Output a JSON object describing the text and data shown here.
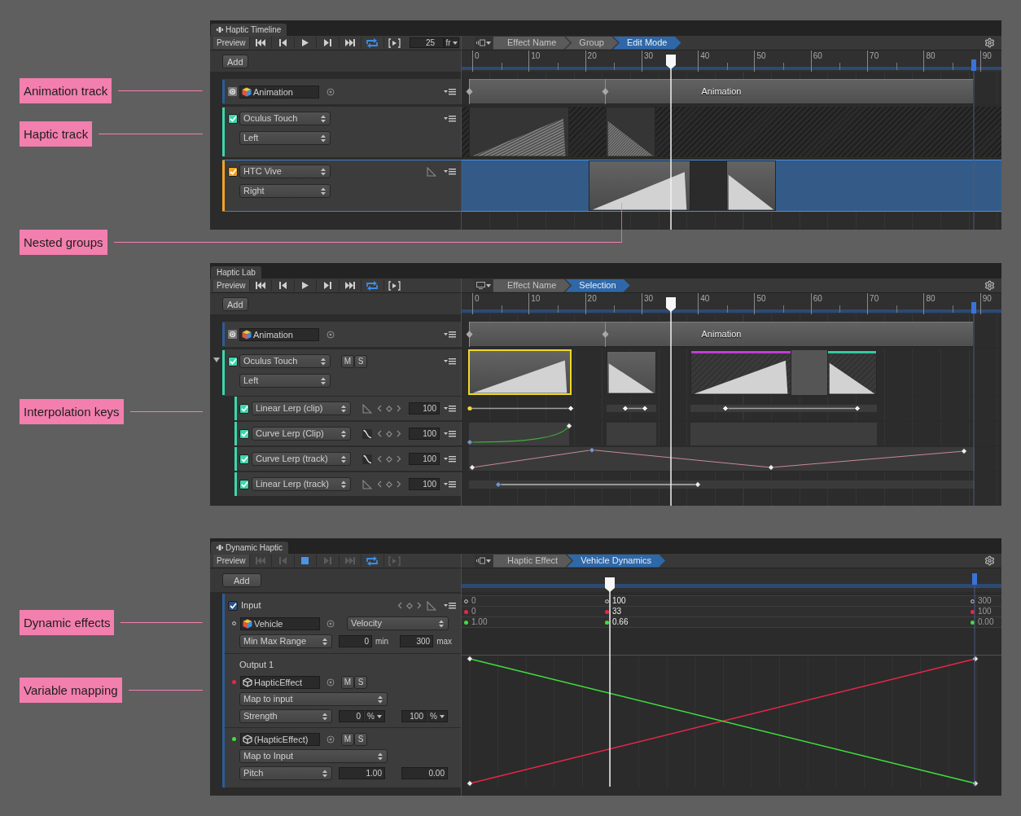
{
  "annotations": [
    {
      "text": "Animation track"
    },
    {
      "text": "Haptic track"
    },
    {
      "text": "Nested groups"
    },
    {
      "text": "Interpolation keys"
    },
    {
      "text": "Dynamic effects"
    },
    {
      "text": "Variable mapping"
    }
  ],
  "panels": [
    {
      "kind": "timeline",
      "tab": {
        "title": "Haptic Timeline",
        "icon": true
      },
      "toolbar": {
        "preview": "Preview",
        "playing": false,
        "loop": true,
        "frame": "25",
        "unit": "fr"
      },
      "breadcrumb": [
        {
          "label": "Effect Name",
          "selected": false
        },
        {
          "label": "Group",
          "selected": false
        },
        {
          "label": "Edit Mode",
          "selected": true
        }
      ],
      "add": "Add",
      "ruler": [
        "0",
        "10",
        "20",
        "30",
        "40",
        "50",
        "60",
        "70",
        "80",
        "90"
      ],
      "tracks": [
        {
          "kind": "animation",
          "color": "#2d5c96",
          "selected": false,
          "object": "Animation",
          "clip": "Animation"
        },
        {
          "kind": "haptic",
          "color": "#3dd6ac",
          "checked": true,
          "selected": false,
          "device": "Oculus Touch",
          "hand": "Left",
          "clips": [
            {
              "selected": false
            },
            {
              "selected": false
            }
          ]
        },
        {
          "kind": "haptic",
          "color": "#f3a423",
          "checked": true,
          "selected": true,
          "device": "HTC Vive",
          "hand": "Right",
          "curve_icon": true,
          "clips": [
            {
              "selected": false
            },
            {
              "selected": false
            }
          ]
        }
      ]
    },
    {
      "kind": "timeline",
      "tab": {
        "title": "Haptic Lab"
      },
      "toolbar": {
        "preview": "Preview",
        "playing": false,
        "loop": true
      },
      "breadcrumb": [
        {
          "label": "Effect Name",
          "selected": false
        },
        {
          "label": "Selection",
          "selected": true
        }
      ],
      "add": "Add",
      "ruler": [
        "0",
        "10",
        "20",
        "30",
        "40",
        "50",
        "60",
        "70",
        "80",
        "90"
      ],
      "tracks": [
        {
          "kind": "animation",
          "color": "#2d5c96",
          "selected": false,
          "object": "Animation",
          "clip": "Animation"
        },
        {
          "kind": "haptic",
          "color": "#3dd6ac",
          "checked": true,
          "selected": false,
          "expanded": true,
          "device": "Oculus Touch",
          "hand": "Left",
          "buttons": [
            "M",
            "S"
          ],
          "clips": [
            {
              "selected": true
            },
            {
              "selected": false
            },
            {
              "selected": false,
              "color": "#c43bd9"
            },
            {
              "selected": false,
              "color": "#33c9a2"
            }
          ],
          "children": [
            {
              "kind": "linear",
              "checked": true,
              "mode": "Linear Lerp (clip)",
              "value": "100"
            },
            {
              "kind": "ease",
              "checked": true,
              "mode": "Curve Lerp (Clip)",
              "value": "100"
            },
            {
              "kind": "ease",
              "checked": true,
              "mode": "Curve Lerp (track)",
              "value": "100"
            },
            {
              "kind": "linear",
              "checked": true,
              "mode": "Linear Lerp (track)",
              "value": "100"
            }
          ]
        }
      ]
    },
    {
      "kind": "dynamic",
      "tab": {
        "title": "Dynamic Haptic",
        "icon": true
      },
      "toolbar": {
        "preview": "Preview",
        "playing": true,
        "loop": true
      },
      "breadcrumb": [
        {
          "label": "Haptic Effect",
          "selected": false
        },
        {
          "label": "Vehicle Dynamics",
          "selected": true
        }
      ],
      "add": "Add",
      "input": {
        "checked": true,
        "label": "Input",
        "curve_icon": true,
        "object": "Vehicle",
        "property": "Velocity",
        "range_mode": "Min Max Range",
        "min": "0",
        "min_label": "min",
        "max": "300",
        "max_label": "max",
        "values": [
          "0",
          "100",
          "300"
        ]
      },
      "outputs": [
        {
          "label": "Output 1",
          "color": "#e8264a",
          "object": "HapticEffect",
          "buttons": [
            "M",
            "S"
          ],
          "mapping": "Map to input",
          "parameter": "Strength",
          "from": "0",
          "from_unit": "%",
          "to": "100",
          "to_unit": "%",
          "values": [
            "0",
            "33",
            "100"
          ]
        },
        {
          "color": "#3ee03e",
          "object": "(HapticEffect)",
          "buttons": [
            "M",
            "S"
          ],
          "mapping": "Map to Input",
          "parameter": "Pitch",
          "from": "1.00",
          "to": "0.00",
          "values": [
            "1.00",
            "0.66",
            "0.00"
          ]
        }
      ]
    }
  ]
}
